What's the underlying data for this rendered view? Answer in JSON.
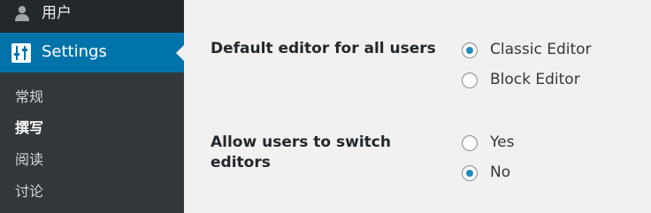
{
  "sidebar": {
    "top_item": {
      "label": "用户",
      "icon": "user-icon"
    },
    "active_item": {
      "label": "Settings",
      "icon": "settings-sliders-icon"
    },
    "submenu": [
      {
        "label": "常规",
        "current": false
      },
      {
        "label": "撰写",
        "current": true
      },
      {
        "label": "阅读",
        "current": false
      },
      {
        "label": "讨论",
        "current": false
      }
    ]
  },
  "settings": {
    "default_editor": {
      "label": "Default editor for all users",
      "options": [
        {
          "label": "Classic Editor",
          "selected": true
        },
        {
          "label": "Block Editor",
          "selected": false
        }
      ]
    },
    "allow_switch": {
      "label": "Allow users to switch editors",
      "options": [
        {
          "label": "Yes",
          "selected": false
        },
        {
          "label": "No",
          "selected": true
        }
      ]
    }
  },
  "colors": {
    "sidebar_bg": "#23282d",
    "submenu_bg": "#32373c",
    "active_bg": "#0073aa",
    "content_bg": "#f1f1f1",
    "radio_dot": "#1e8cbe"
  }
}
